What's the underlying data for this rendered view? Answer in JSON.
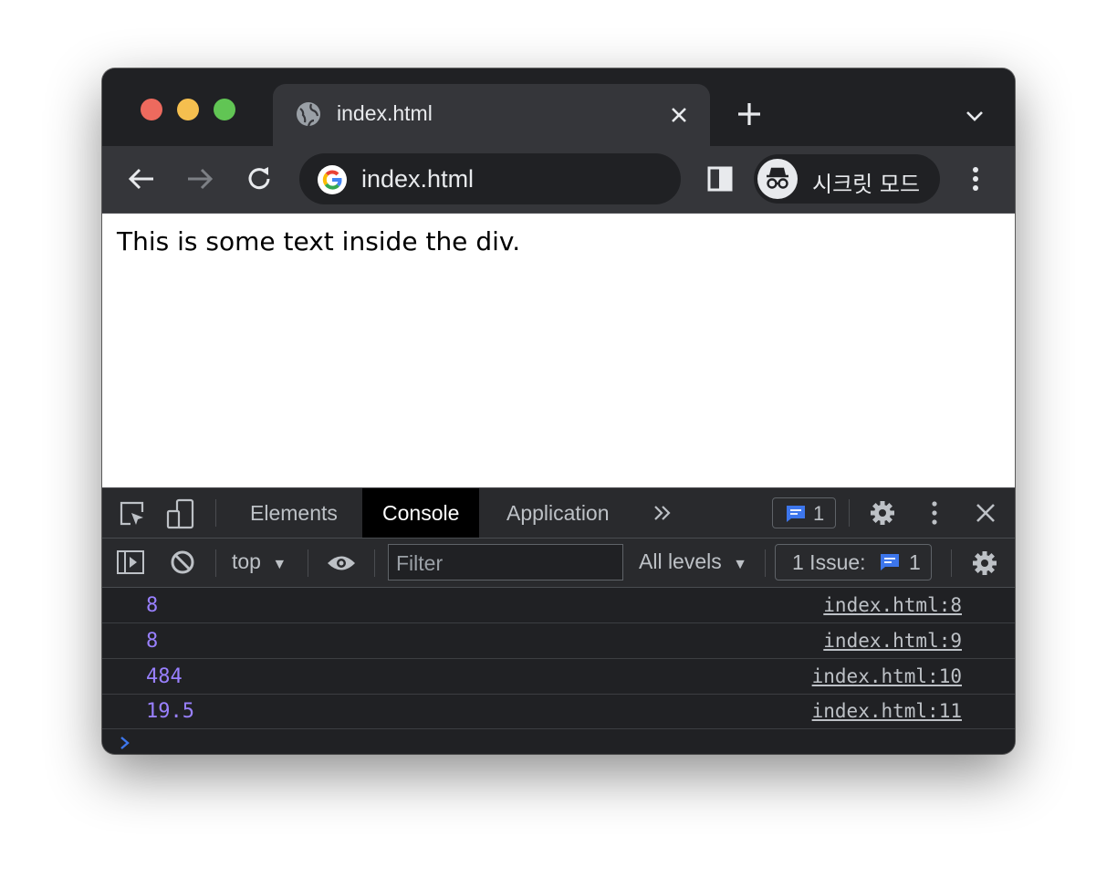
{
  "browser": {
    "tab_title": "index.html",
    "url": "index.html",
    "profile_label": "시크릿 모드"
  },
  "page": {
    "text": "This is some text inside the div."
  },
  "devtools": {
    "tabs": [
      "Elements",
      "Console",
      "Application"
    ],
    "active_tab": "Console",
    "issues_badge_count": "1",
    "context": "top",
    "filter_placeholder": "Filter",
    "levels": "All levels",
    "issues_label": "1 Issue:",
    "issues_count": "1",
    "logs": [
      {
        "value": "8",
        "source": "index.html:8"
      },
      {
        "value": "8",
        "source": "index.html:9"
      },
      {
        "value": "484",
        "source": "index.html:10"
      },
      {
        "value": "19.5",
        "source": "index.html:11"
      }
    ]
  },
  "colors": {
    "chrome_dark": "#202124",
    "toolbar": "#35363a",
    "log_value": "#9980ff",
    "accent_blue": "#3d76ec"
  }
}
